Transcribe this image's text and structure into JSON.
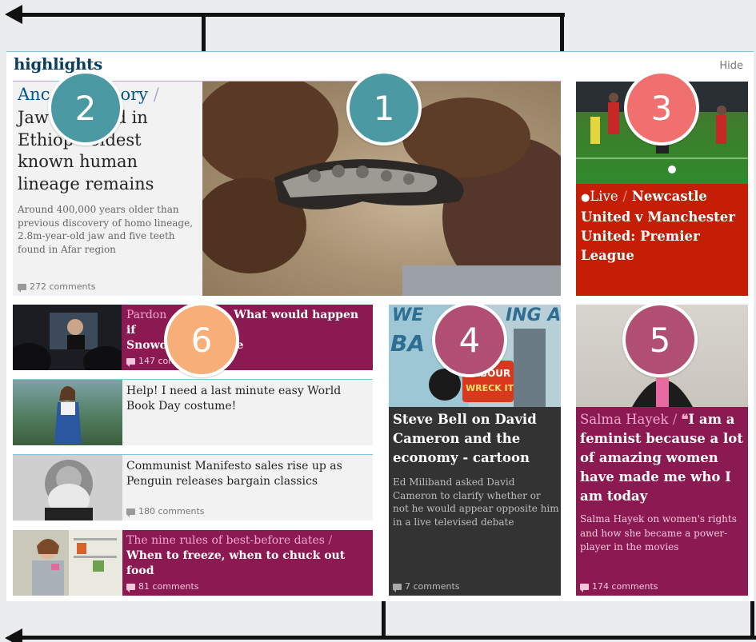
{
  "section": {
    "title": "highlights",
    "hide_label": "Hide"
  },
  "lead": {
    "kicker": "Ancient history",
    "kicker_visible_left": "Anc",
    "kicker_visible_right": "ory",
    "separator": "/",
    "headline_lines": [
      "Jaw",
      "nd in",
      "Ethiop",
      "oldest",
      "known human",
      "lineage remains"
    ],
    "standfirst": "Around 400,000 years older than previous discovery of homo lineage, 2.8m-year-old jaw and five teeth found in Afar region",
    "comments": "272 comments",
    "image": "fossil-jaw-photo"
  },
  "live": {
    "live_label": "Live",
    "separator": "/",
    "headline_part1": "Newcastle",
    "headline_rest": "United v Manchester United: Premier League",
    "image": "football-match-photo"
  },
  "small_cards": [
    {
      "kicker": "Pardon",
      "headline_left": "Snowd",
      "headline_right": "What would happen if",
      "headline_tail": "e",
      "comments": "147 comments",
      "image": "snowden-screen-photo"
    },
    {
      "headline": "Help! I need a last minute easy World Book Day costume!",
      "image": "girl-costume-photo"
    },
    {
      "headline": "Communist Manifesto sales rise up as Penguin releases bargain classics",
      "comments": "180 comments",
      "image": "karl-marx-portrait"
    },
    {
      "kicker": "The nine rules of best-before dates",
      "separator": "/",
      "headline": "When to freeze, when to chuck out food",
      "comments": "81 comments",
      "image": "fridge-woman-photo"
    }
  ],
  "cartoon": {
    "headline": "Steve Bell on David Cameron and the economy - cartoon",
    "standfirst": "Ed Miliband asked David Cameron to clarify whether or not he would appear opposite him in a live televised debate",
    "comments": "7 comments",
    "cartoon_words": [
      "WE",
      "ING A",
      "BA",
      "LABOUR",
      "WRECK IT"
    ]
  },
  "feature": {
    "kicker": "Salma Hayek",
    "separator": "/",
    "quote_mark": "❝",
    "headline": "I am a feminist because a lot of amazing women have made me who I am today",
    "standfirst": "Salma Hayek on women's rights and how she became a power-player in the movies",
    "comments": "174 comments",
    "image": "salma-hayek-portrait"
  },
  "badges": [
    "1",
    "2",
    "3",
    "4",
    "5",
    "6"
  ],
  "colors": {
    "teal_badge": "#4b9aa3",
    "red_badge": "#f0706f",
    "plum_badge": "#b14f72",
    "orange_badge": "#f8ae78",
    "live_red": "#c41f06",
    "feature_plum": "#8c1a52",
    "cartoon_dark": "#333333",
    "title_blue": "#0b3e5a",
    "kicker_blue": "#005689"
  }
}
